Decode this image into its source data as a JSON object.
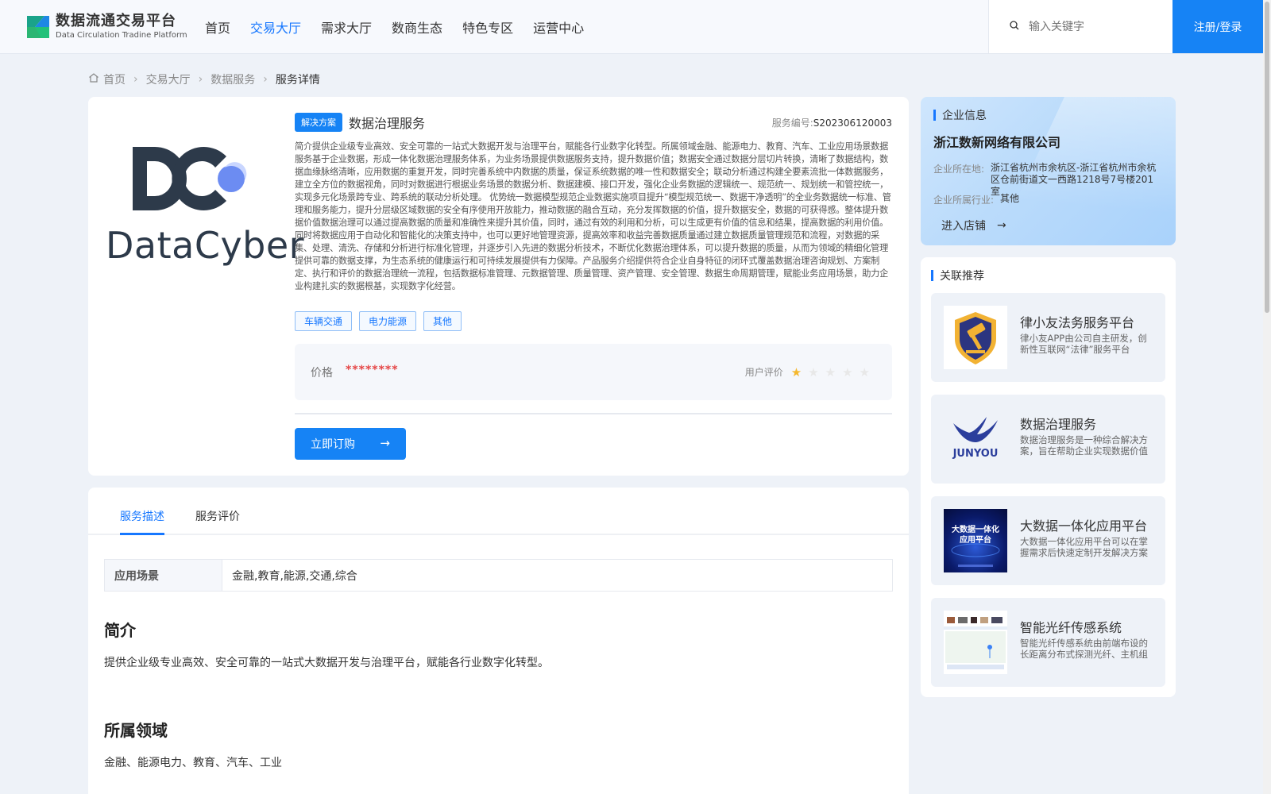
{
  "header": {
    "logo_cn": "数据流通交易平台",
    "logo_en": "Data Circulation Tradine Platform",
    "nav": [
      "首页",
      "交易大厅",
      "需求大厅",
      "数商生态",
      "特色专区",
      "运营中心"
    ],
    "active_nav": "交易大厅",
    "search_placeholder": "输入关键字",
    "login_label": "注册/登录"
  },
  "breadcrumb": [
    "首页",
    "交易大厅",
    "数据服务",
    "服务详情"
  ],
  "service": {
    "logo_text": "DataCyber",
    "type_tag": "解决方案",
    "title": "数据治理服务",
    "number_label": "服务编号:",
    "number": "S202306120003",
    "description": "简介提供企业级专业高效、安全可靠的一站式大数据开发与治理平台，赋能各行业数字化转型。所属领域金融、能源电力、教育、汽车、工业应用场景数据服务基于企业数据，形成一体化数据治理服务体系，为业务场景提供数据服务支持，提升数据价值；数据安全通过数据分层切片转换，清晰了数据结构，数据血缘脉络清晰，应用数据的重复开发，同时完善系统中内数据的质量，保证系统数据的唯一性和数据安全；联动分析通过构建全要素流批一体数据服务，建立全方位的数据视角，同时对数据进行根据业务场景的数据分析、数据建模、接口开发，强化企业务数据的逻辑统一、规范统一、规划统一和管控统一，实现多元化场景跨专业、跨系统的联动分析处理。 优势统一数据模型规范企业数据实施项目提升“模型规范统一、数据干净透明”的全业务数据统一标准、管理和服务能力，提升分层级区域数据的安全有序使用开放能力，推动数据的融合互动，充分发挥数据的价值，提升数据安全，数据的可获得感。整体提升数据价值数据治理可以通过提高数据的质量和准确性来提升其价值，同时，通过有效的利用和分析，可以生成更有价值的信息和结果，提高数据的利用价值。同时将数据应用于自动化和智能化的决策支持中，也可以更好地管理资源，提高效率和收益完善数据质量通过建立数据质量管理规范和流程，对数据的采集、处理、清洗、存储和分析进行标准化管理，并逐步引入先进的数据分析技术，不断优化数据治理体系，可以提升数据的质量，从而为领域的精细化管理提供可靠的数据支撑，为生态系统的健康运行和可持续发展提供有力保障。产品服务介绍提供符合企业自身特征的闭环式覆盖数据治理咨询规划、方案制定、执行和评价的数据治理统一流程，包括数据标准管理、元数据管理、质量管理、资产管理、安全管理、数据生命周期管理，赋能业务应用场景，助力企业构建扎实的数据根基，实现数字化经营。",
    "tags": [
      "车辆交通",
      "电力能源",
      "其他"
    ],
    "price_label": "价格",
    "price_value": "********",
    "rating_label": "用户评价",
    "rating": 1,
    "rating_max": 5,
    "order_label": "立即订购"
  },
  "detail": {
    "tabs": [
      "服务描述",
      "服务评价"
    ],
    "active_tab": "服务描述",
    "scene_key": "应用场景",
    "scene_value": "金融,教育,能源,交通,综合",
    "intro_title": "简介",
    "intro_text": "提供企业级专业高效、安全可靠的一站式大数据开发与治理平台，赋能各行业数字化转型。",
    "domain_title": "所属领域",
    "domain_text": "金融、能源电力、教育、汽车、工业"
  },
  "enterprise": {
    "section_title": "企业信息",
    "name": "浙江数新网络有限公司",
    "location_label": "企业所在地:",
    "location": "浙江省杭州市余杭区-浙江省杭州市余杭区仓前街道文一西路1218号7号楼201室",
    "industry_label": "企业所属行业:",
    "industry": "其他",
    "shop_label": "进入店铺"
  },
  "recommend": {
    "section_title": "关联推荐",
    "items": [
      {
        "title": "律小友法务服务平台",
        "desc": "律小友APP由公司自主研发，创新性互联网“法律”服务平台",
        "icon": "shield-hammer-icon"
      },
      {
        "title": "数据治理服务",
        "desc": "数据治理服务是一种综合解决方案，旨在帮助企业实现数据价值",
        "icon": "junyou-logo",
        "logo_text": "JUNYOU"
      },
      {
        "title": "大数据一体化应用平台",
        "desc": "大数据一体化应用平台可以在掌握需求后快速定制开发解决方案",
        "icon": "bigdata-cover",
        "cover_text": "大数据一体化应用平台"
      },
      {
        "title": "智能光纤传感系统",
        "desc": "智能光纤传感系统由前端布设的长距离分布式探测光纤、主机组成",
        "icon": "fiber-map-thumb"
      }
    ]
  },
  "colors": {
    "accent": "#1683f5",
    "price": "#e54545",
    "star_on": "#f5b82e"
  }
}
